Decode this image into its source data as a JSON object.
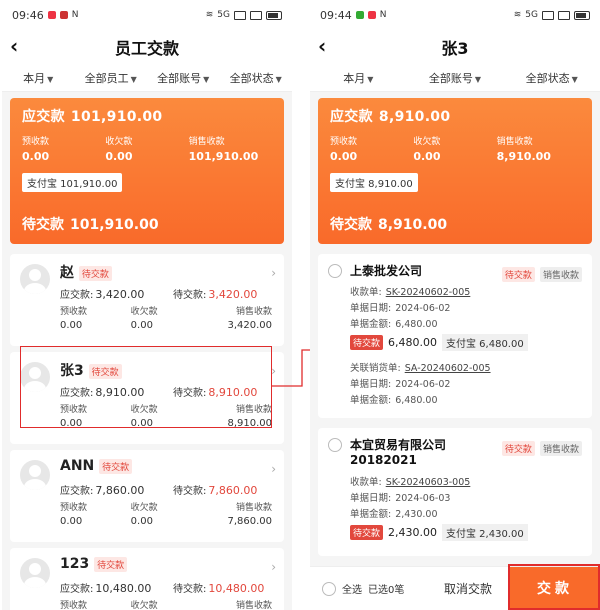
{
  "left": {
    "status": {
      "time": "09:46",
      "signal": "5G"
    },
    "title": "员工交款",
    "filters": [
      "本月",
      "全部员工",
      "全部账号",
      "全部状态"
    ],
    "summary": {
      "due_label": "应交款",
      "due_value": "101,910.00",
      "cols": [
        {
          "label": "预收款",
          "value": "0.00"
        },
        {
          "label": "收欠款",
          "value": "0.00"
        },
        {
          "label": "销售收款",
          "value": "101,910.00"
        }
      ],
      "pay_chip": "支付宝  101,910.00",
      "pending_label": "待交款",
      "pending_value": "101,910.00"
    },
    "employees": [
      {
        "name": "赵",
        "status": "待交款",
        "due_label": "应交款:",
        "due": "3,420.00",
        "pending_label": "待交款:",
        "pending": "3,420.00",
        "cols": [
          {
            "label": "预收款",
            "value": "0.00"
          },
          {
            "label": "收欠款",
            "value": "0.00"
          },
          {
            "label": "销售收款",
            "value": "3,420.00"
          }
        ]
      },
      {
        "name": "张3",
        "status": "待交款",
        "due_label": "应交款:",
        "due": "8,910.00",
        "pending_label": "待交款:",
        "pending": "8,910.00",
        "cols": [
          {
            "label": "预收款",
            "value": "0.00"
          },
          {
            "label": "收欠款",
            "value": "0.00"
          },
          {
            "label": "销售收款",
            "value": "8,910.00"
          }
        ]
      },
      {
        "name": "ANN",
        "status": "待交款",
        "due_label": "应交款:",
        "due": "7,860.00",
        "pending_label": "待交款:",
        "pending": "7,860.00",
        "cols": [
          {
            "label": "预收款",
            "value": "0.00"
          },
          {
            "label": "收欠款",
            "value": "0.00"
          },
          {
            "label": "销售收款",
            "value": "7,860.00"
          }
        ]
      },
      {
        "name": "123",
        "status": "待交款",
        "due_label": "应交款:",
        "due": "10,480.00",
        "pending_label": "待交款:",
        "pending": "10,480.00",
        "cols": [
          {
            "label": "预收款",
            "value": ""
          },
          {
            "label": "收欠款",
            "value": ""
          },
          {
            "label": "销售收款",
            "value": ""
          }
        ]
      }
    ]
  },
  "right": {
    "status": {
      "time": "09:44",
      "signal": "5G"
    },
    "title": "张3",
    "filters": [
      "本月",
      "全部账号",
      "全部状态"
    ],
    "summary": {
      "due_label": "应交款",
      "due_value": "8,910.00",
      "cols": [
        {
          "label": "预收款",
          "value": "0.00"
        },
        {
          "label": "收欠款",
          "value": "0.00"
        },
        {
          "label": "销售收款",
          "value": "8,910.00"
        }
      ],
      "pay_chip": "支付宝  8,910.00",
      "pending_label": "待交款",
      "pending_value": "8,910.00"
    },
    "orders": [
      {
        "company": "上泰批发公司",
        "tag1": "待交款",
        "tag2": "销售收款",
        "receipt_label": "收款单:",
        "receipt_no": "SK-20240602-005",
        "date_label": "单据日期:",
        "date": "2024-06-02",
        "amount_label": "单据金额:",
        "amount": "6,480.00",
        "pay_tag": "待交款",
        "pay_amount": "6,480.00",
        "pay_method": "支付宝  6,480.00",
        "rel_label": "关联销货单:",
        "rel_no": "SA-20240602-005",
        "rel_date_label": "单据日期:",
        "rel_date": "2024-06-02",
        "rel_amount_label": "单据金额:",
        "rel_amount": "6,480.00"
      },
      {
        "company": "本宜贸易有限公司",
        "company2": "20182021",
        "tag1": "待交款",
        "tag2": "销售收款",
        "receipt_label": "收款单:",
        "receipt_no": "SK-20240603-005",
        "date_label": "单据日期:",
        "date": "2024-06-03",
        "amount_label": "单据金额:",
        "amount": "2,430.00",
        "pay_tag": "待交款",
        "pay_amount": "2,430.00",
        "pay_method": "支付宝  2,430.00"
      }
    ],
    "bottom": {
      "select_all": "全选",
      "selected": "已选0笔",
      "cancel": "取消交款",
      "pay": "交款"
    }
  },
  "colors": {
    "accent": "#f96a2a",
    "red": "#e2483d",
    "highlight": "#e02c2c"
  }
}
